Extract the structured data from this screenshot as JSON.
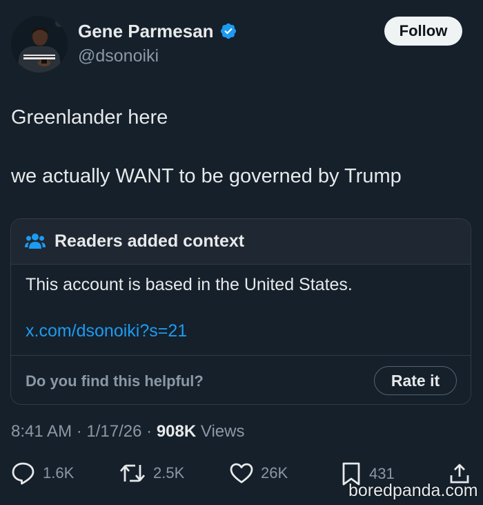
{
  "author": {
    "name": "Gene Parmesan",
    "handle": "@dsonoiki",
    "verified_color": "#1d9bf0",
    "avatar": "person-in-track-jacket-photo"
  },
  "follow_label": "Follow",
  "tweet": {
    "lines": [
      "Greenlander here",
      "we actually WANT to be governed by Trump"
    ]
  },
  "context_note": {
    "icon": "people-icon",
    "title": "Readers added context",
    "body": "This account is based in the United States.",
    "link": "x.com/dsonoiki?s=21",
    "question": "Do you find this helpful?",
    "rate_label": "Rate it"
  },
  "meta": {
    "time": "8:41 AM",
    "separator": "·",
    "date": "1/17/26",
    "views_count": "908K",
    "views_label": "Views"
  },
  "actions": {
    "replies": "1.6K",
    "reposts": "2.5K",
    "likes": "26K",
    "bookmarks": "431"
  },
  "watermark": "boredpanda.com",
  "colors": {
    "background": "#15202b",
    "text": "#e7e9ea",
    "muted": "#8b98a5",
    "link": "#1d9bf0",
    "border": "#2f3b47"
  }
}
